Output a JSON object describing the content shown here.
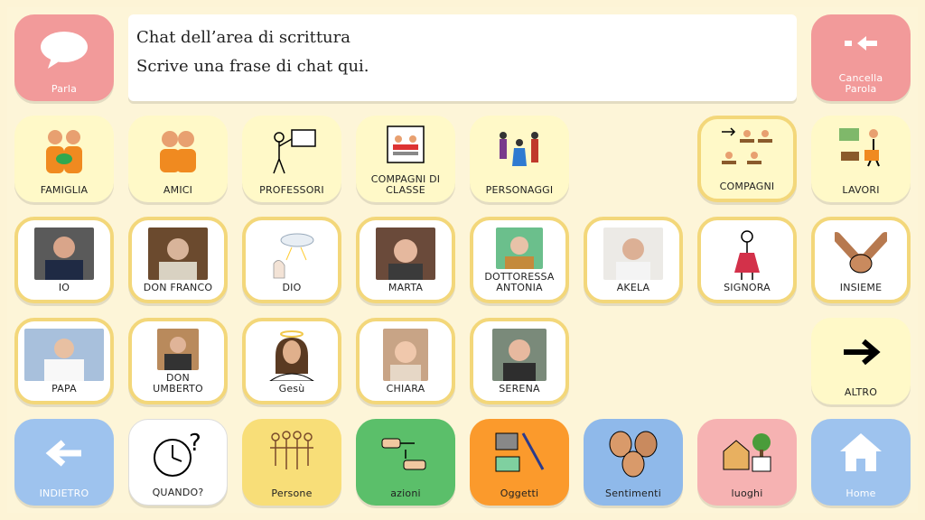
{
  "top": {
    "speak_label": "Parla",
    "chat_line1": "Chat dell’area di scrittura",
    "chat_line2": "Scrive una frase di chat qui.",
    "clear_label_line1": "Cancella",
    "clear_label_line2": "Parola"
  },
  "row1": [
    "FAMIGLIA",
    "AMICI",
    "PROFESSORI",
    "COMPAGNI DI CLASSE",
    "PERSONAGGI",
    "COMPAGNI",
    "LAVORI"
  ],
  "row2": [
    "IO",
    "DON FRANCO",
    "DIO",
    "MARTA",
    "DOTTORESSA ANTONIA",
    "AKELA",
    "SIGNORA",
    "INSIEME"
  ],
  "row3": [
    "PAPA",
    "DON UMBERTO",
    "Gesù",
    "CHIARA",
    "SERENA",
    "ALTRO"
  ],
  "nav": [
    "INDIETRO",
    "QUANDO?",
    "Persone",
    "azioni",
    "Oggetti",
    "Sentimenti",
    "luoghi",
    "Home"
  ],
  "colors": {
    "background": "#fdf5d8",
    "speak": "#f29a9a",
    "category": "#fff9c8",
    "person_border": "#f3d77a",
    "back": "#9ec3ee",
    "persone": "#f8de78",
    "azioni": "#5bbf6a",
    "oggetti": "#fb9a2c",
    "sentimenti": "#8fb9ea",
    "luoghi": "#f6b2b2",
    "home": "#9ec3ee"
  }
}
